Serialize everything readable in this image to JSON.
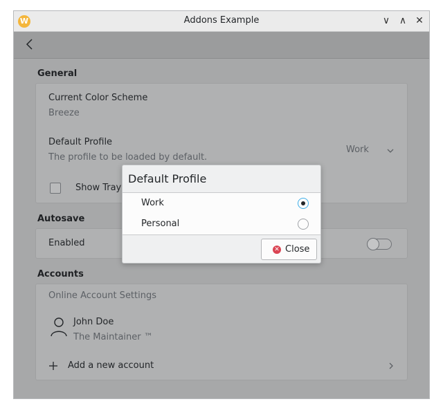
{
  "window": {
    "title": "Addons Example",
    "app_icon_letter": "W",
    "controls": {
      "minimize": "∨",
      "maximize": "∧",
      "close": "✕"
    }
  },
  "general": {
    "section_title": "General",
    "color_scheme_label": "Current Color Scheme",
    "color_scheme_value": "Breeze",
    "default_profile_label": "Default Profile",
    "default_profile_desc": "The profile to be loaded by default.",
    "default_profile_value": "Work",
    "tray_label": "Show Tray I"
  },
  "autosave": {
    "section_title": "Autosave",
    "enabled_label": "Enabled",
    "enabled": false
  },
  "accounts": {
    "section_title": "Accounts",
    "online_settings_label": "Online Account Settings",
    "account_name": "John Doe",
    "account_role": "The Maintainer ™",
    "add_account_label": "Add a new account"
  },
  "dialog": {
    "title": "Default Profile",
    "options": [
      {
        "label": "Work",
        "selected": true
      },
      {
        "label": "Personal",
        "selected": false
      }
    ],
    "close_label": "Close"
  },
  "colors": {
    "accent": "#3daee9",
    "close_icon": "#da4453",
    "app_icon": "#f4b63c"
  }
}
